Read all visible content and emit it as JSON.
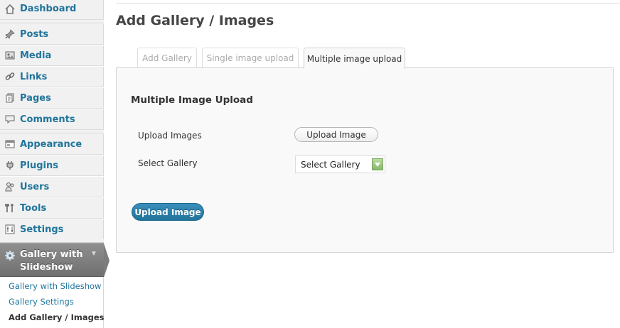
{
  "sidebar": {
    "items": [
      {
        "label": "Dashboard",
        "icon": "dashboard-icon"
      },
      {
        "label": "Posts",
        "icon": "pushpin-icon"
      },
      {
        "label": "Media",
        "icon": "media-icon"
      },
      {
        "label": "Links",
        "icon": "chain-link-icon"
      },
      {
        "label": "Pages",
        "icon": "pages-icon"
      },
      {
        "label": "Comments",
        "icon": "comment-bubble-icon"
      },
      {
        "label": "Appearance",
        "icon": "appearance-icon"
      },
      {
        "label": "Plugins",
        "icon": "plug-icon"
      },
      {
        "label": "Users",
        "icon": "users-icon"
      },
      {
        "label": "Tools",
        "icon": "tools-icon"
      },
      {
        "label": "Settings",
        "icon": "settings-icon"
      }
    ],
    "current": {
      "label": "Gallery with Slideshow",
      "icon": "gear-icon"
    },
    "submenu": [
      {
        "label": "Gallery with Slideshow"
      },
      {
        "label": "Gallery Settings"
      },
      {
        "label": "Add Gallery / Images"
      }
    ]
  },
  "page": {
    "title": "Add Gallery / Images"
  },
  "tabs": [
    {
      "label": "Add Gallery",
      "active": false
    },
    {
      "label": "Single image upload",
      "active": false
    },
    {
      "label": "Multiple image upload",
      "active": true
    }
  ],
  "panel": {
    "heading": "Multiple Image Upload",
    "upload_label": "Upload Images",
    "upload_button": "Upload Image",
    "gallery_label": "Select Gallery",
    "gallery_select": {
      "selected": "Select Gallery"
    },
    "submit_button": "Upload Image"
  },
  "colors": {
    "link": "#21759b",
    "current_menu_bg": "#7d7d7d",
    "primary_button": "#21759b",
    "select_arrow": "#86b86a"
  }
}
